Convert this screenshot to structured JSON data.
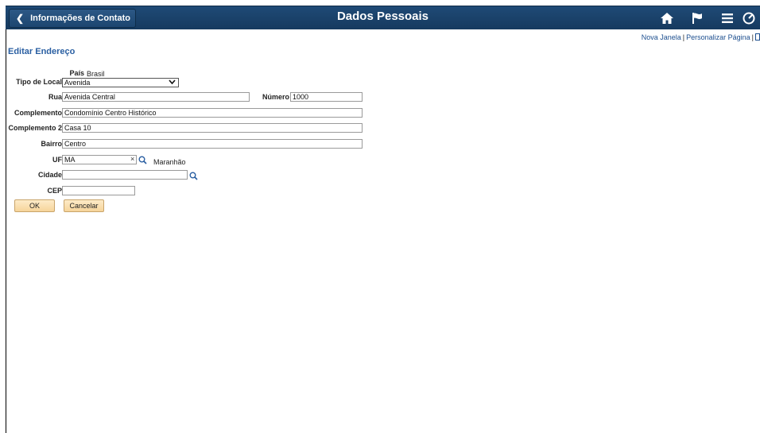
{
  "header": {
    "back_label": "Informações de Contato",
    "title": "Dados Pessoais",
    "icons": [
      "home-icon",
      "flag-icon",
      "menu-icon",
      "navbar-icon"
    ]
  },
  "links": {
    "new_window": "Nova Janela",
    "personalize": "Personalizar Página"
  },
  "form": {
    "title": "Editar Endereço",
    "pais": {
      "label": "País",
      "value": "Brasil"
    },
    "tipo_local": {
      "label": "Tipo de Local",
      "value": "Avenida"
    },
    "rua": {
      "label": "Rua",
      "value": "Avenida Central"
    },
    "numero": {
      "label": "Número",
      "value": "1000"
    },
    "complemento": {
      "label": "Complemento",
      "value": "Condomínio Centro Histórico"
    },
    "complemento2": {
      "label": "Complemento 2",
      "value": "Casa 10"
    },
    "bairro": {
      "label": "Bairro",
      "value": "Centro"
    },
    "uf": {
      "label": "UF",
      "value": "MA",
      "description": "Maranhão",
      "clear_glyph": "×"
    },
    "cidade": {
      "label": "Cidade",
      "value": ""
    },
    "cep": {
      "label": "CEP",
      "value": ""
    }
  },
  "buttons": {
    "ok": "OK",
    "cancel": "Cancelar"
  },
  "colors": {
    "header_bg": "#1f4a76",
    "link": "#1d4f8f",
    "section_title": "#2a5fa2",
    "button_bg": "#f6d49a"
  }
}
